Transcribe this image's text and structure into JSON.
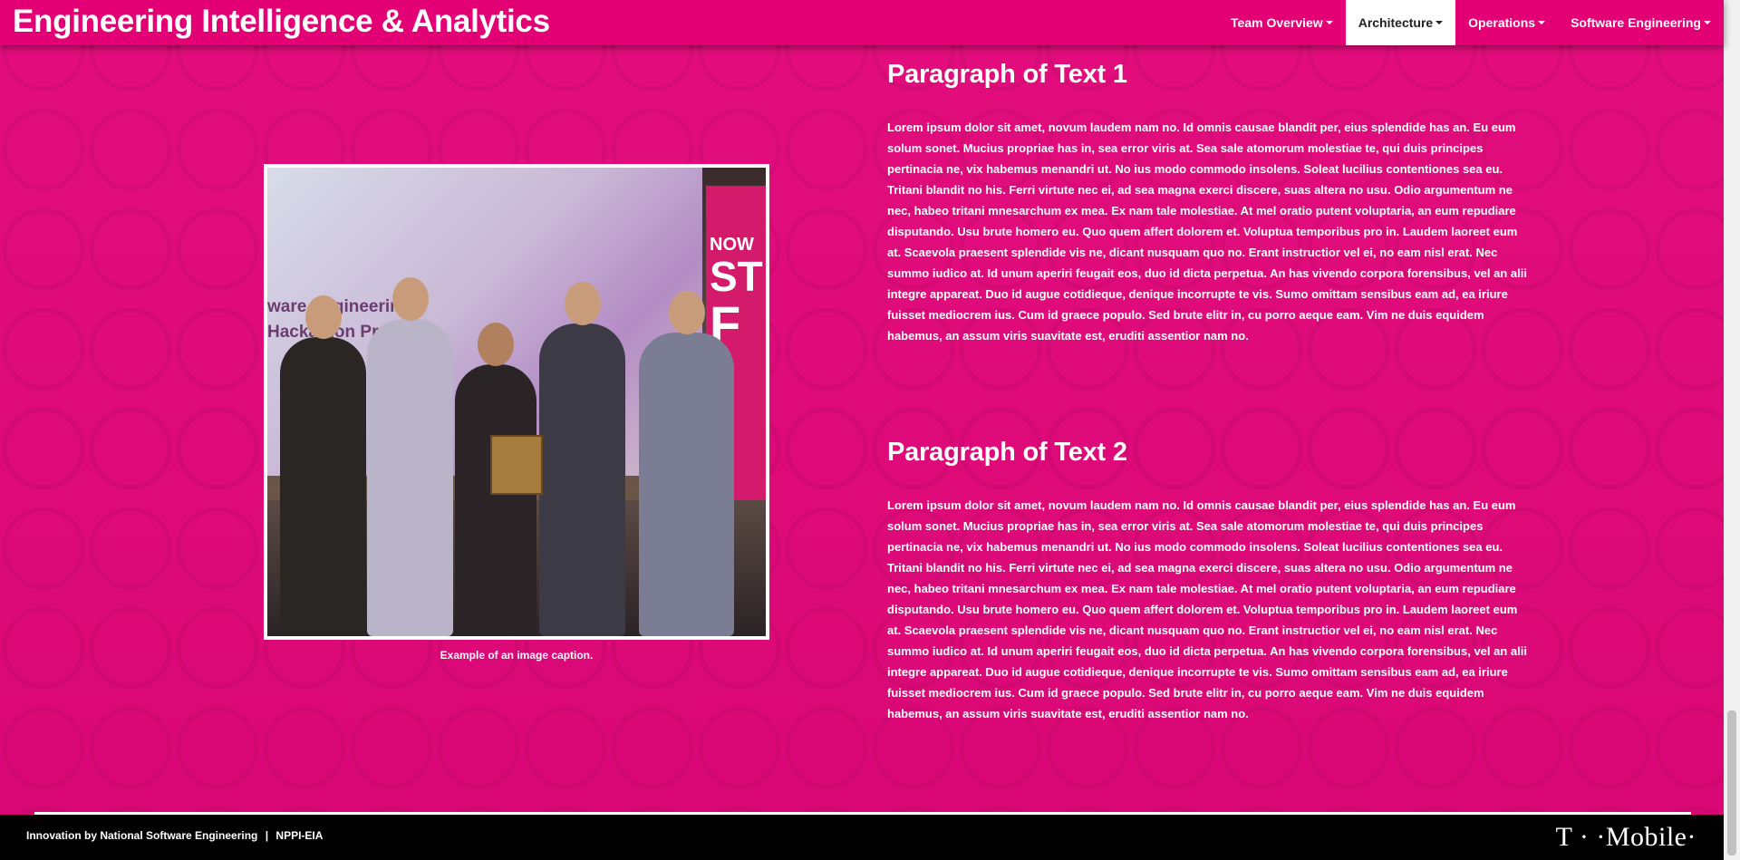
{
  "app": {
    "brand": "Engineering Intelligence & Analytics"
  },
  "nav": {
    "items": [
      {
        "label": "Team Overview",
        "active": false
      },
      {
        "label": "Architecture",
        "active": true
      },
      {
        "label": "Operations",
        "active": false
      },
      {
        "label": "Software Engineering",
        "active": false
      }
    ]
  },
  "figure": {
    "caption": "Example of an image caption.",
    "photo_screen_text": [
      "ware Engineering",
      "Hackathon Presen"
    ],
    "photo_banner_text": [
      "NOW",
      "ST",
      "F"
    ]
  },
  "sections": [
    {
      "title": "Paragraph of Text 1",
      "body": "Lorem ipsum dolor sit amet, novum laudem nam no. Id omnis causae blandit per, eius splendide has an. Eu eum solum sonet. Mucius propriae has in, sea error viris at. Sea sale atomorum molestiae te, qui duis principes pertinacia ne, vix habemus menandri ut. No ius modo commodo insolens. Soleat lucilius contentiones sea eu. Tritani blandit no his. Ferri virtute nec ei, ad sea magna exerci discere, suas altera no usu. Odio argumentum ne nec, habeo tritani mnesarchum ex mea. Ex nam tale molestiae. At mel oratio putent voluptaria, an eum repudiare disputando. Usu brute homero eu. Quo quem affert dolorem et. Voluptua temporibus pro in. Laudem laoreet eum at. Scaevola praesent splendide vis ne, dicant nusquam quo no. Erant instructior vel ei, no eam nisl erat. Nec summo iudico at. Id unum aperiri feugait eos, duo id dicta perpetua. An has vivendo corpora forensibus, vel an alii integre appareat. Duo id augue cotidieque, denique incorrupte te vis. Sumo omittam sensibus eam ad, ea iriure fuisset mediocrem ius. Cum id graece populo. Sed brute elitr in, cu porro aeque eam. Vim ne duis equidem habemus, an assum viris suavitate est, eruditi assentior nam no."
    },
    {
      "title": "Paragraph of Text 2",
      "body": "Lorem ipsum dolor sit amet, novum laudem nam no. Id omnis causae blandit per, eius splendide has an. Eu eum solum sonet. Mucius propriae has in, sea error viris at. Sea sale atomorum molestiae te, qui duis principes pertinacia ne, vix habemus menandri ut. No ius modo commodo insolens. Soleat lucilius contentiones sea eu. Tritani blandit no his. Ferri virtute nec ei, ad sea magna exerci discere, suas altera no usu. Odio argumentum ne nec, habeo tritani mnesarchum ex mea. Ex nam tale molestiae. At mel oratio putent voluptaria, an eum repudiare disputando. Usu brute homero eu. Quo quem affert dolorem et. Voluptua temporibus pro in. Laudem laoreet eum at. Scaevola praesent splendide vis ne, dicant nusquam quo no. Erant instructior vel ei, no eam nisl erat. Nec summo iudico at. Id unum aperiri feugait eos, duo id dicta perpetua. An has vivendo corpora forensibus, vel an alii integre appareat. Duo id augue cotidieque, denique incorrupte te vis. Sumo omittam sensibus eam ad, ea iriure fuisset mediocrem ius. Cum id graece populo. Sed brute elitr in, cu porro aeque eam. Vim ne duis equidem habemus, an assum viris suavitate est, eruditi assentior nam no."
    }
  ],
  "footer": {
    "credit": "Innovation by National Software Engineering",
    "separator": "|",
    "team": "NPPI-EIA",
    "logo_text": "T · ·Mobile·"
  },
  "colors": {
    "brand_magenta": "#e20074",
    "footer_bg": "#000000",
    "active_tab_bg": "#ffffff"
  }
}
